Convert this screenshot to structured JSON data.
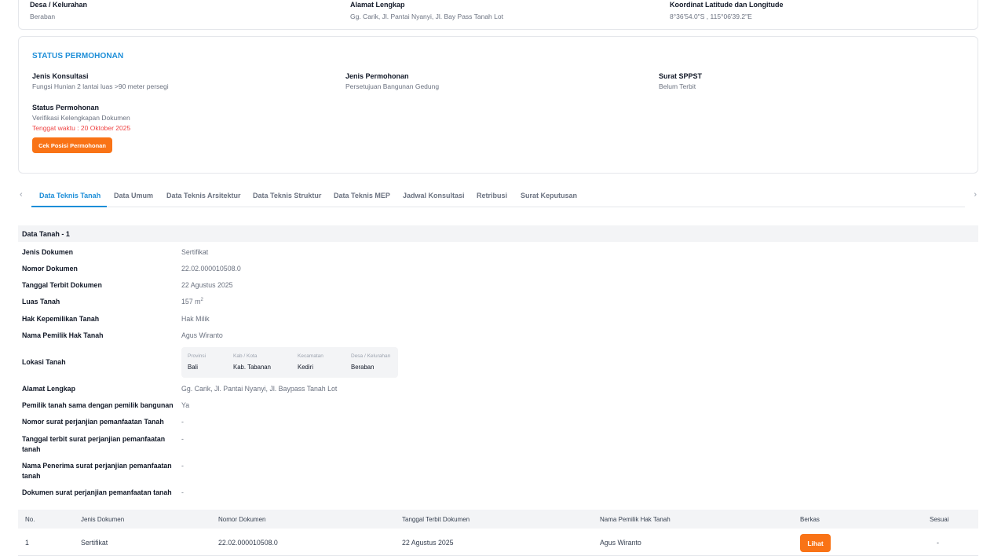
{
  "location_card": {
    "desa_label": "Desa / Kelurahan",
    "desa_value": "Beraban",
    "alamat_label": "Alamat Lengkap",
    "alamat_value": "Gg. Carik, Jl. Pantai Nyanyi, Jl. Bay Pass Tanah Lot",
    "koordinat_label": "Koordinat Latitude dan Longitude",
    "koordinat_value": "8°36'54.0\"S , 115°06'39.2\"E"
  },
  "status": {
    "title": "STATUS PERMOHONAN",
    "jenis_konsultasi_label": "Jenis Konsultasi",
    "jenis_konsultasi_value": "Fungsi Hunian 2 lantai luas >90 meter persegi",
    "jenis_permohonan_label": "Jenis Permohonan",
    "jenis_permohonan_value": "Persetujuan Bangunan Gedung",
    "surat_label": "Surat SPPST",
    "surat_value": "Belum Terbit",
    "status_label": "Status Permohonan",
    "status_value": "Verifikasi Kelengkapan Dokumen",
    "deadline": "Tenggat waktu : 20 Oktober 2025",
    "button_label": "Cek Posisi Permohonan",
    "accent_color": "#1d8ed8",
    "button_color": "#f97316"
  },
  "tabs": [
    {
      "label": "Data Teknis Tanah",
      "active": true
    },
    {
      "label": "Data Umum",
      "active": false
    },
    {
      "label": "Data Teknis Arsitektur",
      "active": false
    },
    {
      "label": "Data Teknis Struktur",
      "active": false
    },
    {
      "label": "Data Teknis MEP",
      "active": false
    },
    {
      "label": "Jadwal Konsultasi",
      "active": false
    },
    {
      "label": "Retribusi",
      "active": false
    },
    {
      "label": "Surat Keputusan",
      "active": false
    }
  ],
  "tab_icons": {
    "prev": "chevron-left-icon",
    "next": "chevron-right-icon"
  },
  "data_tanah": {
    "title": "Data Tanah - 1",
    "rows": [
      {
        "label": "Jenis Dokumen",
        "value": "Sertifikat"
      },
      {
        "label": "Nomor Dokumen",
        "value": "22.02.000010508.0"
      },
      {
        "label": "Tanggal Terbit Dokumen",
        "value": "22 Agustus 2025"
      },
      {
        "label": "Luas Tanah",
        "value": "157 m",
        "unit_sup": "2"
      },
      {
        "label": "Hak Kepemilikan Tanah",
        "value": "Hak Milik"
      },
      {
        "label": "Nama Pemilik Hak Tanah",
        "value": "Agus Wiranto"
      },
      {
        "label": "Lokasi Tanah",
        "value": ""
      },
      {
        "label": "Alamat Lengkap",
        "value": "Gg. Carik, Jl. Pantai Nyanyi, Jl. Baypass Tanah Lot"
      },
      {
        "label": "Pemilik tanah sama dengan pemilik bangunan",
        "value": "Ya"
      },
      {
        "label": "Nomor surat perjanjian pemanfaatan Tanah",
        "value": "-"
      },
      {
        "label": "Tanggal terbit surat perjanjian pemanfaatan tanah",
        "value": "-"
      },
      {
        "label": "Nama Penerima surat perjanjian pemanfaatan tanah",
        "value": "-"
      },
      {
        "label": "Dokumen surat perjanjian pemanfaatan tanah",
        "value": "-"
      }
    ],
    "lokasi": {
      "provinsi_label": "Provinsi",
      "provinsi": "Bali",
      "kab_label": "Kab / Kota",
      "kab": "Kab. Tabanan",
      "kec_label": "Kecamatan",
      "kec": "Kediri",
      "desa_label": "Desa / Kelurahan",
      "desa": "Beraban"
    }
  },
  "table": {
    "headers": [
      "No.",
      "Jenis Dokumen",
      "Nomor Dokumen",
      "Tanggal Terbit Dokumen",
      "Nama Pemilik Hak Tanah",
      "Berkas",
      "Sesuai"
    ],
    "rows": [
      {
        "no": "1",
        "jenis": "Sertifikat",
        "nomor": "22.02.000010508.0",
        "tanggal": "22 Agustus 2025",
        "nama": "Agus Wiranto",
        "berkas": "Lihat",
        "sesuai": "-"
      }
    ]
  }
}
